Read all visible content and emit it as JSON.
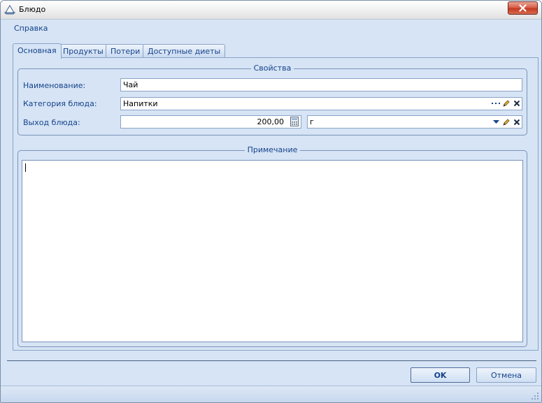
{
  "window": {
    "title": "Блюдо",
    "close_icon": "close-icon",
    "app_icon": "dish-icon"
  },
  "menu": {
    "help_label": "Справка"
  },
  "tabs": [
    {
      "label": "Основная",
      "active": true
    },
    {
      "label": "Продукты",
      "active": false
    },
    {
      "label": "Потери",
      "active": false
    },
    {
      "label": "Доступные диеты",
      "active": false
    }
  ],
  "properties": {
    "group_title": "Свойства",
    "name_label": "Наименование:",
    "name_value": "Чай",
    "category_label": "Категория блюда:",
    "category_value": "Напитки",
    "yield_label": "Выход блюда:",
    "yield_value": "200,00",
    "unit_value": "г"
  },
  "note": {
    "group_title": "Примечание",
    "value": ""
  },
  "buttons": {
    "ok_label": "OK",
    "cancel_label": "Отмена"
  },
  "colors": {
    "background": "#d6e4f5",
    "accent_text": "#15428b",
    "border": "#8aa3c7"
  }
}
